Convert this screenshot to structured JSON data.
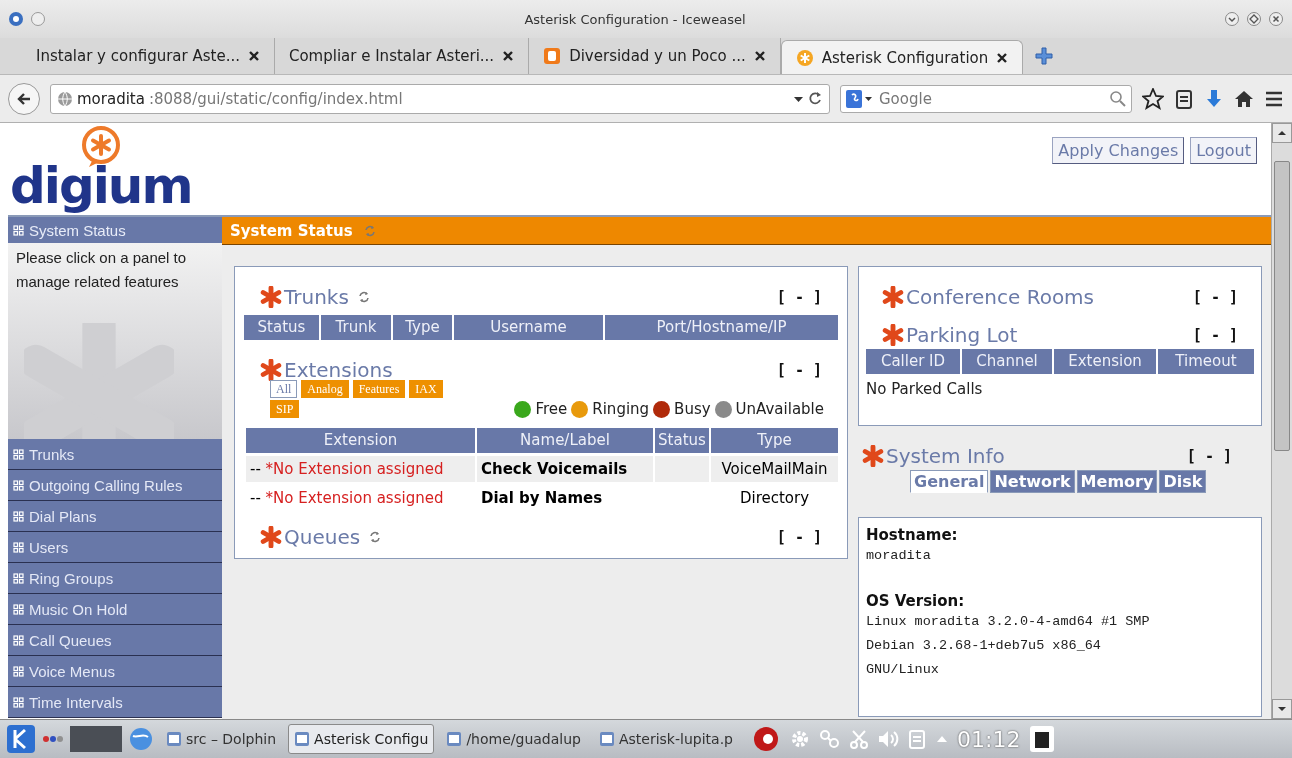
{
  "window": {
    "title": "Asterisk Configuration - Iceweasel"
  },
  "browser_tabs": [
    {
      "label": "Instalar y configurar Aste...",
      "selected": false
    },
    {
      "label": "Compliar e Instalar Asteri...",
      "selected": false
    },
    {
      "label": "Diversidad y un Poco ...",
      "selected": false
    },
    {
      "label": "Asterisk Configuration",
      "selected": true
    }
  ],
  "address_bar": {
    "host": "moradita",
    "path": ":8088/gui/static/config/index.html"
  },
  "search_box": {
    "placeholder": "Google"
  },
  "header_buttons": [
    "Apply Changes",
    "Logout"
  ],
  "logo": {
    "text": "digium"
  },
  "sidebar": {
    "header": "System Status",
    "hint": "Please click on a panel to manage related features",
    "items": [
      "Trunks",
      "Outgoing Calling Rules",
      "Dial Plans",
      "Users",
      "Ring Groups",
      "Music On Hold",
      "Call Queues",
      "Voice Menus",
      "Time Intervals"
    ]
  },
  "page_title": "System Status",
  "trunks": {
    "title": "Trunks",
    "collapse": "[ - ]",
    "columns": [
      "Status",
      "Trunk",
      "Type",
      "Username",
      "Port/Hostname/IP"
    ]
  },
  "extensions": {
    "title": "Extensions",
    "collapse": "[ - ]",
    "filters": [
      {
        "label": "All",
        "selected": true
      },
      {
        "label": "Analog",
        "selected": false
      },
      {
        "label": "Features",
        "selected": false
      },
      {
        "label": "IAX",
        "selected": false
      },
      {
        "label": "SIP",
        "selected": false
      }
    ],
    "legend": [
      {
        "label": "Free",
        "color": "#3aa81c"
      },
      {
        "label": "Ringing",
        "color": "#e89a0c"
      },
      {
        "label": "Busy",
        "color": "#b02a0a"
      },
      {
        "label": "UnAvailable",
        "color": "#8a8a8a"
      }
    ],
    "columns": [
      "Extension",
      "Name/Label",
      "Status",
      "Type"
    ],
    "rows": [
      {
        "prefix": "--",
        "extension": "*No Extension assigned",
        "name": "Check Voicemails",
        "type": "VoiceMailMain"
      },
      {
        "prefix": "--",
        "extension": "*No Extension assigned",
        "name": "Dial by Names",
        "type": "Directory"
      }
    ]
  },
  "queues": {
    "title": "Queues",
    "collapse": "[ - ]"
  },
  "conference_rooms": {
    "title": "Conference Rooms",
    "collapse": "[ - ]"
  },
  "parking_lot": {
    "title": "Parking Lot",
    "collapse": "[ - ]",
    "columns": [
      "Caller ID",
      "Channel",
      "Extension",
      "Timeout"
    ],
    "empty_message": "No Parked Calls"
  },
  "system_info": {
    "title": "System Info",
    "collapse": "[ - ]",
    "tabs": [
      {
        "label": "General",
        "selected": true
      },
      {
        "label": "Network",
        "selected": false
      },
      {
        "label": "Memory",
        "selected": false
      },
      {
        "label": "Disk",
        "selected": false
      }
    ],
    "fields": [
      {
        "label": "Hostname:",
        "lines": [
          "moradita"
        ]
      },
      {
        "label": "OS Version:",
        "lines": [
          "Linux moradita 3.2.0-4-amd64 #1 SMP",
          "Debian 3.2.68-1+deb7u5 x86_64",
          "GNU/Linux"
        ]
      }
    ]
  },
  "taskbar": {
    "tasks": [
      {
        "label": "src – Dolphin",
        "selected": false
      },
      {
        "label": "Asterisk Configu",
        "selected": true
      },
      {
        "label": "/home/guadalup",
        "selected": false
      },
      {
        "label": "Asterisk-lupita.p",
        "selected": false
      }
    ],
    "clock": "01:12"
  }
}
